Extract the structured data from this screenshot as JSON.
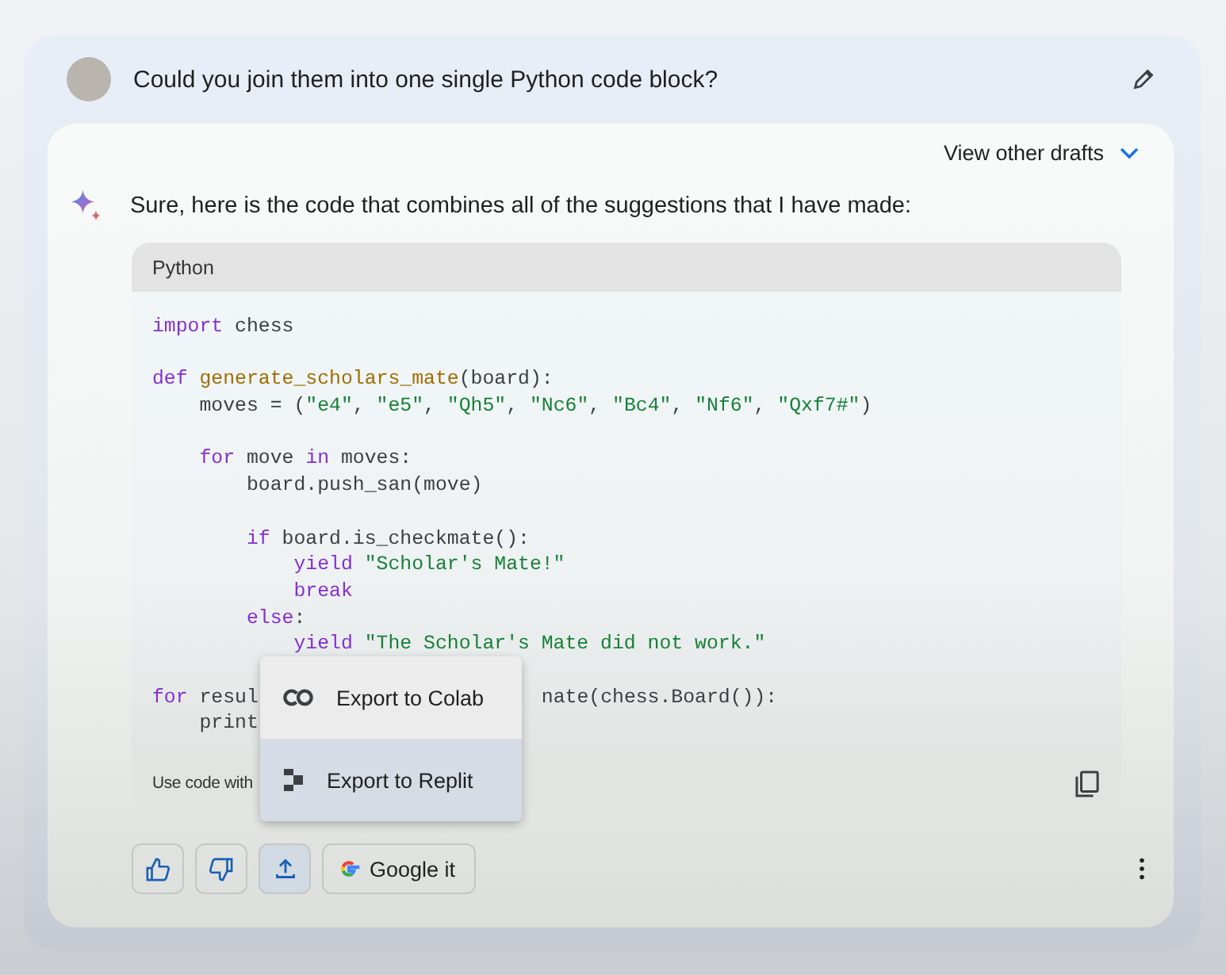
{
  "prompt": {
    "text": "Could you join them into one single Python code block?"
  },
  "drafts": {
    "label": "View other drafts",
    "expanded": false
  },
  "response": {
    "intro": "Sure, here is the code that combines all of the suggestions that I have made:"
  },
  "code": {
    "language": "Python",
    "lines": [
      {
        "kind": "full",
        "tokens": [
          {
            "color": "#8430ce",
            "s": "import"
          },
          {
            "color": "#3c4043",
            "s": " chess"
          }
        ]
      },
      {
        "kind": "blank"
      },
      {
        "kind": "full",
        "tokens": [
          {
            "color": "#8430ce",
            "s": "def "
          },
          {
            "color": "#a06d00",
            "s": "generate_scholars_mate"
          },
          {
            "color": "#3c4043",
            "s": "(board):"
          }
        ]
      },
      {
        "kind": "full",
        "tokens": [
          {
            "color": "#3c4043",
            "s": "    moves = ("
          },
          {
            "color": "#188038",
            "s": "\"e4\""
          },
          {
            "color": "#3c4043",
            "s": ", "
          },
          {
            "color": "#188038",
            "s": "\"e5\""
          },
          {
            "color": "#3c4043",
            "s": ", "
          },
          {
            "color": "#188038",
            "s": "\"Qh5\""
          },
          {
            "color": "#3c4043",
            "s": ", "
          },
          {
            "color": "#188038",
            "s": "\"Nc6\""
          },
          {
            "color": "#3c4043",
            "s": ", "
          },
          {
            "color": "#188038",
            "s": "\"Bc4\""
          },
          {
            "color": "#3c4043",
            "s": ", "
          },
          {
            "color": "#188038",
            "s": "\"Nf6\""
          },
          {
            "color": "#3c4043",
            "s": ", "
          },
          {
            "color": "#188038",
            "s": "\"Qxf7#\""
          },
          {
            "color": "#3c4043",
            "s": ")"
          }
        ]
      },
      {
        "kind": "blank"
      },
      {
        "kind": "full",
        "tokens": [
          {
            "color": "#8430ce",
            "s": "    for"
          },
          {
            "color": "#3c4043",
            "s": " move "
          },
          {
            "color": "#8430ce",
            "s": "in"
          },
          {
            "color": "#3c4043",
            "s": " moves:"
          }
        ]
      },
      {
        "kind": "full",
        "tokens": [
          {
            "color": "#3c4043",
            "s": "        board.push_san(move)"
          }
        ]
      },
      {
        "kind": "blank"
      },
      {
        "kind": "full",
        "tokens": [
          {
            "color": "#8430ce",
            "s": "        if"
          },
          {
            "color": "#3c4043",
            "s": " board.is_checkmate():"
          }
        ]
      },
      {
        "kind": "full",
        "tokens": [
          {
            "color": "#8430ce",
            "s": "            yield"
          },
          {
            "color": "#188038",
            "s": " \"Scholar's Mate!\""
          }
        ]
      },
      {
        "kind": "full",
        "tokens": [
          {
            "color": "#8430ce",
            "s": "            break"
          }
        ]
      },
      {
        "kind": "full",
        "tokens": [
          {
            "color": "#8430ce",
            "s": "        else"
          },
          {
            "color": "#3c4043",
            "s": ":"
          }
        ]
      },
      {
        "kind": "full",
        "tokens": [
          {
            "color": "#8430ce",
            "s": "            yield"
          },
          {
            "color": "#188038",
            "s": " \"The Scholar's Mate did not work.\""
          }
        ]
      },
      {
        "kind": "blank"
      },
      {
        "kind": "split",
        "tokens": [
          {
            "color": "#8430ce",
            "s": "for"
          },
          {
            "color": "#3c4043",
            "s": " resul"
          }
        ],
        "tail": [
          {
            "color": "#3c4043",
            "s": "nate(chess.Board()):"
          }
        ]
      },
      {
        "kind": "full",
        "tokens": [
          {
            "color": "#3c4043",
            "s": "    print"
          }
        ]
      }
    ],
    "footer": "Use code with"
  },
  "export_menu": [
    {
      "kind": "colab",
      "label": "Export to Colab",
      "selected": false
    },
    {
      "kind": "replit",
      "label": "Export to Replit",
      "selected": true
    }
  ],
  "actions": [
    {
      "kind": "thumb-up",
      "selected": false
    },
    {
      "kind": "thumb-down",
      "selected": false
    },
    {
      "kind": "share",
      "selected": true
    },
    {
      "kind": "google",
      "label": "Google it",
      "selected": false
    }
  ]
}
